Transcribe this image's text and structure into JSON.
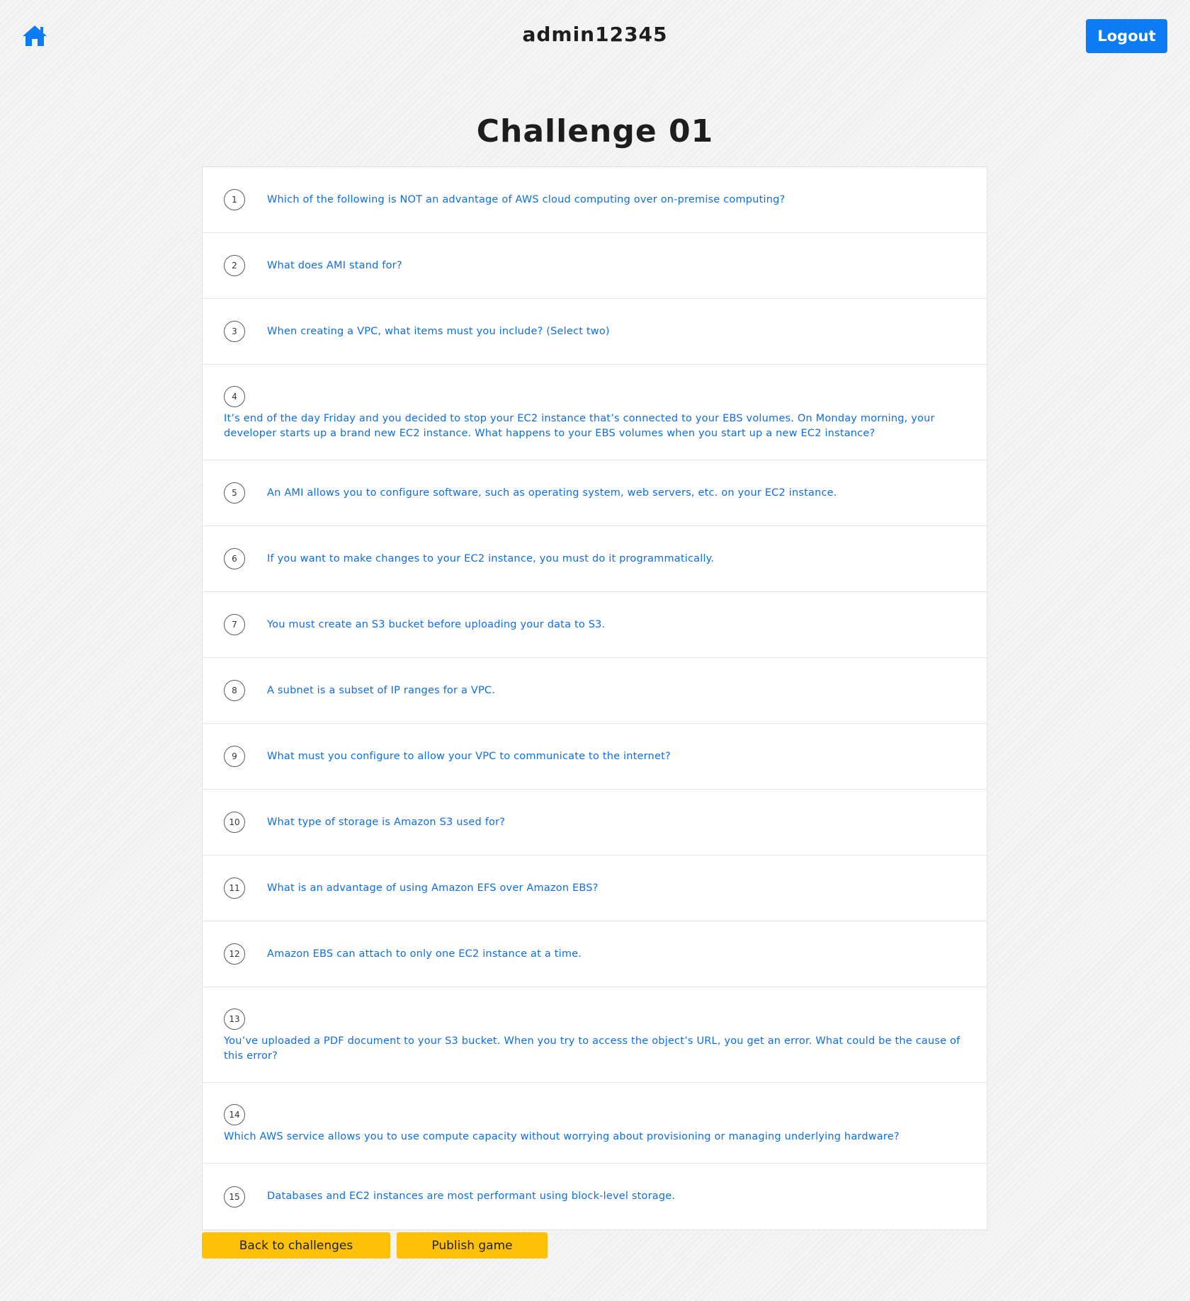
{
  "header": {
    "username": "admin12345",
    "logout_label": "Logout",
    "home_icon": "home-icon",
    "accent_color": "#0d7cf2"
  },
  "page_title": "Challenge 01",
  "questions": [
    {
      "number": "1",
      "text": "Which of the following is NOT an advantage of AWS cloud computing over on-premise computing?"
    },
    {
      "number": "2",
      "text": "What does AMI stand for?"
    },
    {
      "number": "3",
      "text": "When creating a VPC, what items must you include? (Select two)"
    },
    {
      "number": "4",
      "text": "It’s end of the day Friday and you decided to stop your EC2 instance that’s connected to your EBS volumes. On Monday morning, your developer starts up a brand new EC2 instance. What happens to your EBS volumes when you start up a new EC2 instance?"
    },
    {
      "number": "5",
      "text": "An AMI allows you to configure software, such as operating system, web servers, etc. on your EC2 instance."
    },
    {
      "number": "6",
      "text": "If you want to make changes to your EC2 instance, you must do it programmatically."
    },
    {
      "number": "7",
      "text": "You must create an S3 bucket before uploading your data to S3."
    },
    {
      "number": "8",
      "text": "A subnet is a subset of IP ranges for a VPC."
    },
    {
      "number": "9",
      "text": "What must you configure to allow your VPC to communicate to the internet?"
    },
    {
      "number": "10",
      "text": "What type of storage is Amazon S3 used for?"
    },
    {
      "number": "11",
      "text": "What is an advantage of using Amazon EFS over Amazon EBS?"
    },
    {
      "number": "12",
      "text": "Amazon EBS can attach to only one EC2 instance at a time."
    },
    {
      "number": "13",
      "text": "You’ve uploaded a PDF document to your S3 bucket. When you try to access the object’s URL, you get an error. What could be the cause of this error?"
    },
    {
      "number": "14",
      "text": "Which AWS service allows you to use compute capacity without worrying about provisioning or managing underlying hardware?"
    },
    {
      "number": "15",
      "text": "Databases and EC2 instances are most performant using block-level storage."
    }
  ],
  "actions": {
    "back_label": "Back to challenges",
    "publish_label": "Publish game",
    "button_color": "#ffc107"
  }
}
